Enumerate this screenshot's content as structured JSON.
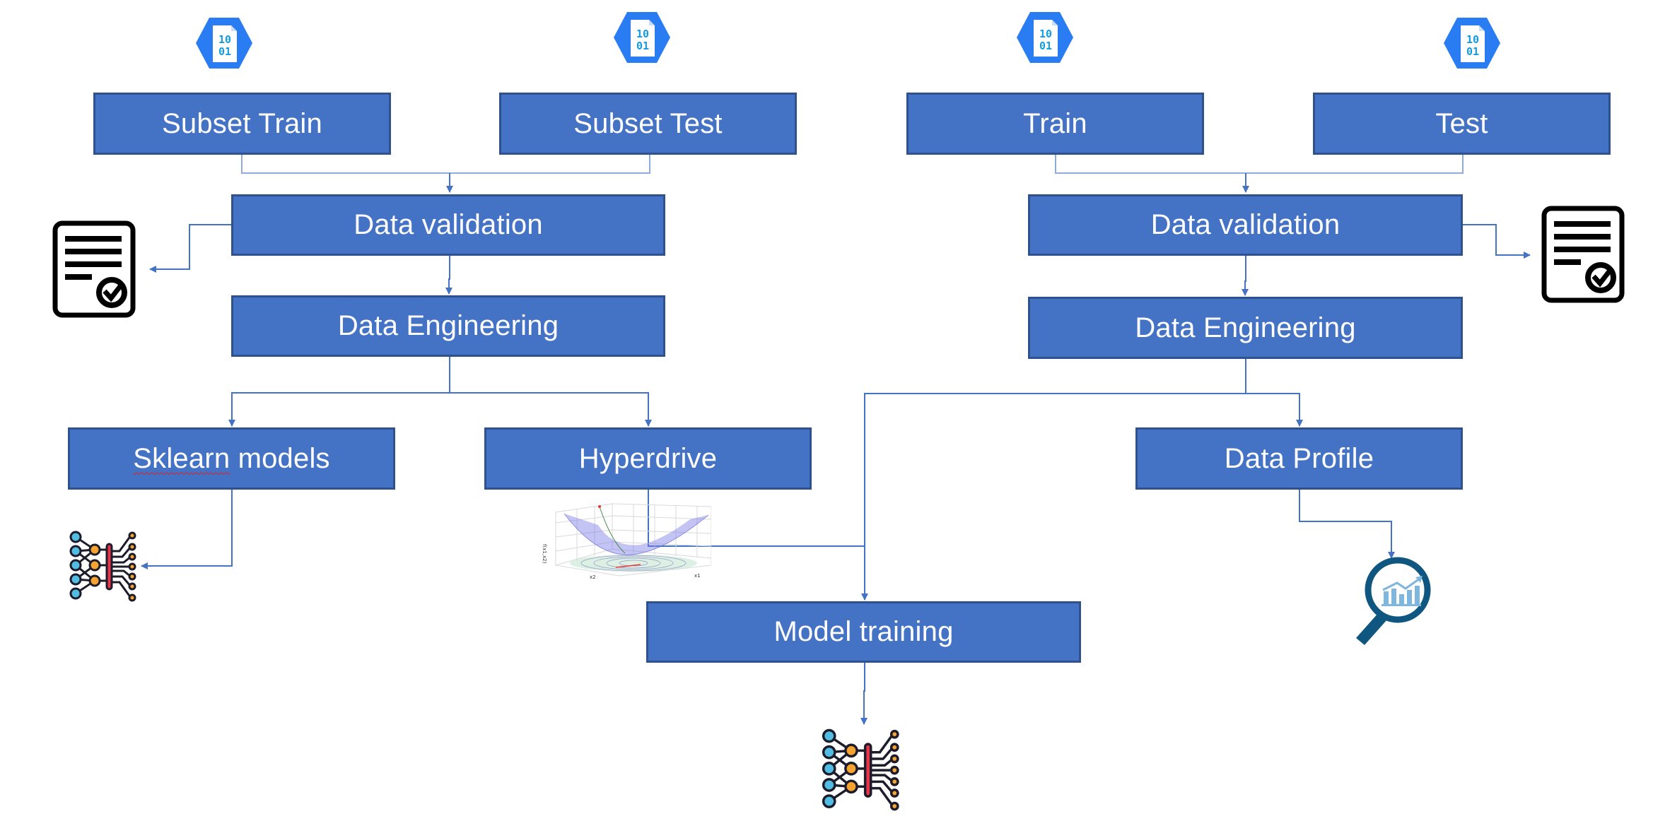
{
  "diagram": {
    "colors": {
      "box_fill": "#4472C4",
      "box_border": "#2F528F",
      "connector": "#4472C4"
    },
    "datasets": [
      {
        "id": "subset-train",
        "label": "Subset Train",
        "icon": "azure-dataset-icon"
      },
      {
        "id": "subset-test",
        "label": "Subset Test",
        "icon": "azure-dataset-icon"
      },
      {
        "id": "train",
        "label": "Train",
        "icon": "azure-dataset-icon"
      },
      {
        "id": "test",
        "label": "Test",
        "icon": "azure-dataset-icon"
      }
    ],
    "left_pipeline": {
      "validation": "Data validation",
      "engineering": "Data Engineering",
      "sklearn_first": "Sklearn",
      "sklearn_rest": " models",
      "hyperdrive": "Hyperdrive",
      "validation_output_icon": "checklist-report-icon",
      "sklearn_output_icon": "neural-network-icon",
      "hyperdrive_output_icon": "loss-surface-plot-icon"
    },
    "right_pipeline": {
      "validation": "Data validation",
      "engineering": "Data Engineering",
      "profile": "Data Profile",
      "validation_output_icon": "checklist-report-icon",
      "profile_output_icon": "magnifier-chart-icon"
    },
    "model_training": {
      "label": "Model training",
      "output_icon": "neural-network-icon"
    },
    "plot_labels": {
      "x1": "x1",
      "x2": "x2",
      "z": "f(x1,x2)"
    }
  }
}
